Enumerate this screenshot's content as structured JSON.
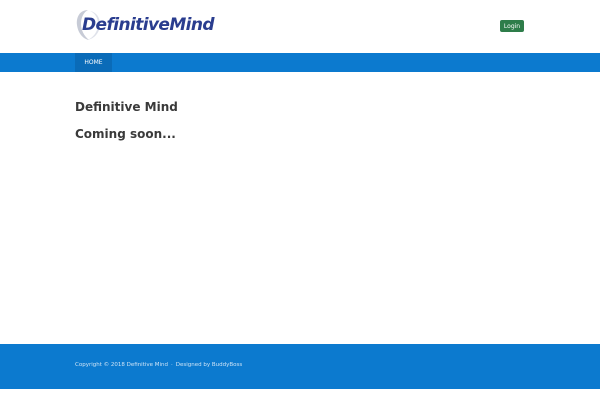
{
  "header": {
    "logo_text": "DefinitiveMind",
    "login_label": "Login"
  },
  "nav": {
    "items": [
      {
        "label": "HOME"
      }
    ]
  },
  "main": {
    "title": "Definitive Mind",
    "status": "Coming soon..."
  },
  "footer": {
    "copyright": "Copyright © 2018 Definitive Mind",
    "separator": "·",
    "credit": "Designed by BuddyBoss"
  },
  "colors": {
    "brand_blue": "#0c7acf",
    "nav_active": "#0a6bb8",
    "login_green": "#2e7d4a",
    "logo_text": "#2a3d8f"
  },
  "icons": {
    "logo": "definitivemind-logo-icon"
  }
}
